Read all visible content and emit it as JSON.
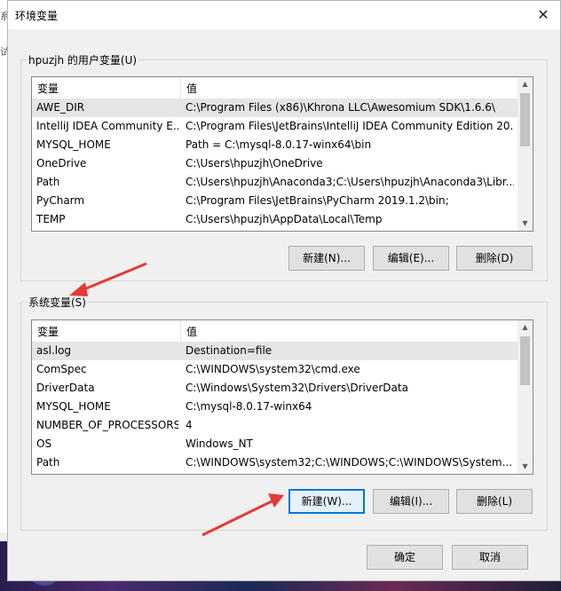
{
  "bg": {
    "left_frags": [
      "系",
      "试"
    ]
  },
  "window": {
    "title": "环境变量",
    "close_glyph": "✕"
  },
  "user_vars": {
    "group_label": "hpuzjh 的用户变量(U)",
    "columns": [
      "变量",
      "值"
    ],
    "rows": [
      {
        "name": "AWE_DIR",
        "value": "C:\\Program Files (x86)\\Khrona LLC\\Awesomium SDK\\1.6.6\\"
      },
      {
        "name": "IntelliJ IDEA Community E...",
        "value": "C:\\Program Files\\JetBrains\\IntelliJ IDEA Community Edition 20..."
      },
      {
        "name": "MYSQL_HOME",
        "value": "Path = C:\\mysql-8.0.17-winx64\\bin"
      },
      {
        "name": "OneDrive",
        "value": "C:\\Users\\hpuzjh\\OneDrive"
      },
      {
        "name": "Path",
        "value": "C:\\Users\\hpuzjh\\Anaconda3;C:\\Users\\hpuzjh\\Anaconda3\\Libr..."
      },
      {
        "name": "PyCharm",
        "value": "C:\\Program Files\\JetBrains\\PyCharm 2019.1.2\\bin;"
      },
      {
        "name": "TEMP",
        "value": "C:\\Users\\hpuzjh\\AppData\\Local\\Temp"
      }
    ],
    "buttons": {
      "new": "新建(N)...",
      "edit": "编辑(E)...",
      "delete": "删除(D)"
    }
  },
  "system_vars": {
    "group_label": "系统变量(S)",
    "columns": [
      "变量",
      "值"
    ],
    "rows": [
      {
        "name": "asl.log",
        "value": "Destination=file"
      },
      {
        "name": "ComSpec",
        "value": "C:\\WINDOWS\\system32\\cmd.exe"
      },
      {
        "name": "DriverData",
        "value": "C:\\Windows\\System32\\Drivers\\DriverData"
      },
      {
        "name": "MYSQL_HOME",
        "value": "C:\\mysql-8.0.17-winx64"
      },
      {
        "name": "NUMBER_OF_PROCESSORS",
        "value": "4"
      },
      {
        "name": "OS",
        "value": "Windows_NT"
      },
      {
        "name": "Path",
        "value": "C:\\WINDOWS\\system32;C:\\WINDOWS;C:\\WINDOWS\\System..."
      }
    ],
    "buttons": {
      "new": "新建(W)...",
      "edit": "编辑(I)...",
      "delete": "删除(L)"
    }
  },
  "footer": {
    "ok": "确定",
    "cancel": "取消"
  },
  "annotation_color": "#e53935",
  "scroll_up": "▲",
  "scroll_down": "▼"
}
